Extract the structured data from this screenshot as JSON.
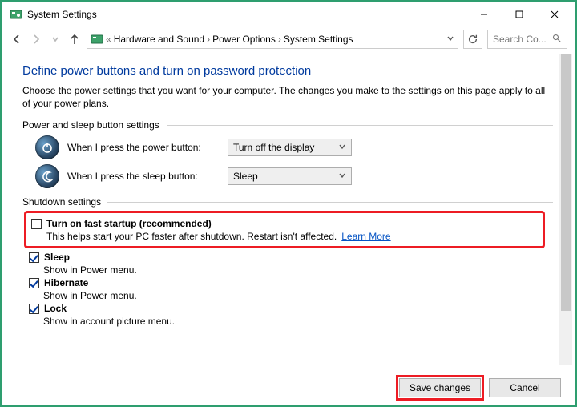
{
  "window": {
    "title": "System Settings"
  },
  "breadcrumb": {
    "prefix": "«",
    "seg1": "Hardware and Sound",
    "seg2": "Power Options",
    "seg3": "System Settings"
  },
  "search": {
    "placeholder": "Search Co..."
  },
  "page": {
    "heading": "Define power buttons and turn on password protection",
    "intro": "Choose the power settings that you want for your computer. The changes you make to the settings on this page apply to all of your power plans."
  },
  "power_sleep_section": {
    "title": "Power and sleep button settings",
    "power_label": "When I press the power button:",
    "power_value": "Turn off the display",
    "sleep_label": "When I press the sleep button:",
    "sleep_value": "Sleep"
  },
  "shutdown_section": {
    "title": "Shutdown settings",
    "fast_startup": {
      "label": "Turn on fast startup (recommended)",
      "desc": "This helps start your PC faster after shutdown. Restart isn't affected. ",
      "link": "Learn More",
      "checked": false
    },
    "sleep": {
      "label": "Sleep",
      "desc": "Show in Power menu.",
      "checked": true
    },
    "hibernate": {
      "label": "Hibernate",
      "desc": "Show in Power menu.",
      "checked": true
    },
    "lock": {
      "label": "Lock",
      "desc": "Show in account picture menu.",
      "checked": true
    }
  },
  "footer": {
    "save": "Save changes",
    "cancel": "Cancel"
  }
}
